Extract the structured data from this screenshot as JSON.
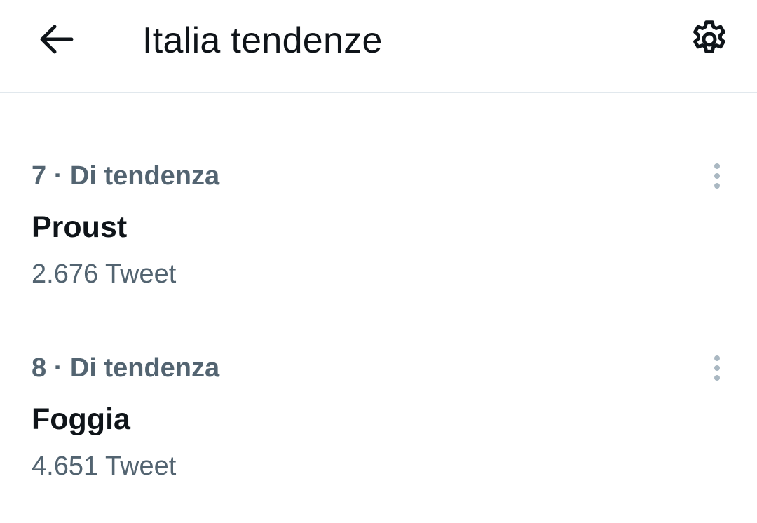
{
  "header": {
    "title": "Italia tendenze",
    "back_icon": "arrow-left-icon",
    "settings_icon": "gear-icon"
  },
  "trends": [
    {
      "meta": "7 · Di tendenza",
      "name": "Proust",
      "count": "2.676 Tweet"
    },
    {
      "meta": "8 · Di tendenza",
      "name": "Foggia",
      "count": "4.651 Tweet"
    }
  ],
  "colors": {
    "text_primary": "#0f1419",
    "text_secondary": "#536471",
    "divider": "#e1e8ed",
    "more_dots": "#aab8c2"
  }
}
